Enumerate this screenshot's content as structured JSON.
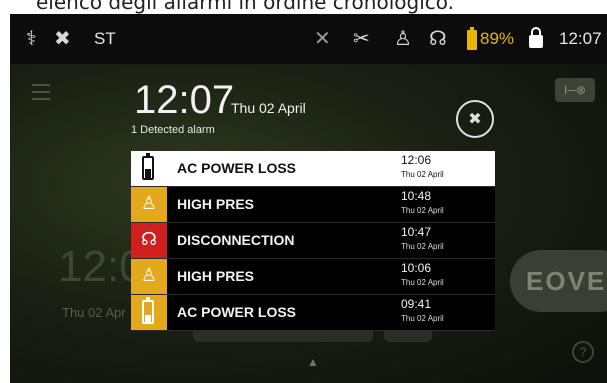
{
  "caption": "elenco degli allarmi in ordine cronologico.",
  "status_bar": {
    "left_label": "ST",
    "battery_percent": "89%",
    "clock": "12:07",
    "battery_color": "#e9b400"
  },
  "background": {
    "time": "12:0",
    "date": "Thu 02 Apr",
    "button_label": "I─⊗",
    "brand": "EOVE",
    "help": "?"
  },
  "alarm_panel": {
    "time": "12:07",
    "date": "Thu 02 April",
    "count_text": "1 Detected alarm",
    "mute_icon": "alarm-mute-icon",
    "alarms": [
      {
        "label": "AC POWER LOSS",
        "time": "12:06",
        "date": "Thu 02 April",
        "icon": "battery-icon",
        "selected": true
      },
      {
        "label": "HIGH PRES",
        "time": "10:48",
        "date": "Thu 02 April",
        "icon": "patient-icon",
        "color": "#e3a81c"
      },
      {
        "label": "DISCONNECTION",
        "time": "10:47",
        "date": "Thu 02 April",
        "icon": "disconnection-icon",
        "color": "#d01f1f"
      },
      {
        "label": "HIGH PRES",
        "time": "10:06",
        "date": "Thu 02 April",
        "icon": "patient-icon",
        "color": "#e3a81c"
      },
      {
        "label": "AC POWER LOSS",
        "time": "09:41",
        "date": "Thu 02 April",
        "icon": "battery-icon",
        "color": "#e3a81c"
      }
    ]
  }
}
